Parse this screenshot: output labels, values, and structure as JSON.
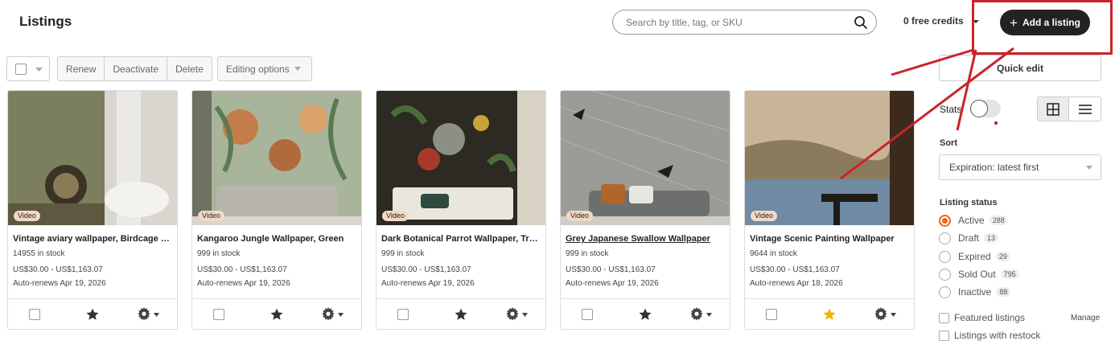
{
  "header": {
    "title": "Listings",
    "search_placeholder": "Search by title, tag, or SKU",
    "credits": "0 free credits",
    "add_button": "Add a listing"
  },
  "toolbar": {
    "renew": "Renew",
    "deactivate": "Deactivate",
    "delete": "Delete",
    "editing_options": "Editing options"
  },
  "listings": [
    {
      "title": "Vintage aviary wallpaper, Birdcage wallpaper",
      "stock": "14955 in stock",
      "price": "US$30.00 - US$1,163.07",
      "renews": "Auto-renews Apr 19, 2026",
      "badge": "Video",
      "featured": false,
      "title_underlined": false
    },
    {
      "title": "Kangaroo Jungle Wallpaper, Green",
      "stock": "999 in stock",
      "price": "US$30.00 - US$1,163.07",
      "renews": "Auto-renews Apr 19, 2026",
      "badge": "Video",
      "featured": false,
      "title_underlined": false
    },
    {
      "title": "Dark Botanical Parrot Wallpaper, Tropical",
      "stock": "999 in stock",
      "price": "US$30.00 - US$1,163.07",
      "renews": "Auto-renews Apr 19, 2026",
      "badge": "Video",
      "featured": false,
      "title_underlined": false
    },
    {
      "title": "Grey Japanese Swallow Wallpaper",
      "stock": "999 in stock",
      "price": "US$30.00 - US$1,163.07",
      "renews": "Auto-renews Apr 19, 2026",
      "badge": "Video",
      "featured": false,
      "title_underlined": true
    },
    {
      "title": "Vintage Scenic Painting Wallpaper",
      "stock": "9644 in stock",
      "price": "US$30.00 - US$1,163.07",
      "renews": "Auto-renews Apr 18, 2026",
      "badge": "Video",
      "featured": true,
      "title_underlined": false
    }
  ],
  "sidebar": {
    "quick_edit": "Quick edit",
    "stats_label": "Stats",
    "sort_label": "Sort",
    "sort_value": "Expiration: latest first",
    "status_label": "Listing status",
    "statuses": [
      {
        "label": "Active",
        "count": "288",
        "selected": true
      },
      {
        "label": "Draft",
        "count": "13",
        "selected": false
      },
      {
        "label": "Expired",
        "count": "29",
        "selected": false
      },
      {
        "label": "Sold Out",
        "count": "795",
        "selected": false
      },
      {
        "label": "Inactive",
        "count": "88",
        "selected": false
      }
    ],
    "featured_listings": "Featured listings",
    "manage": "Manage",
    "listings_with_restock": "Listings with restock"
  },
  "colors": {
    "accent": "#f1641e",
    "button_dark": "#222222",
    "annotation": "#c8242b",
    "featured_star": "#f1b600"
  },
  "icons": {
    "search": "search-icon",
    "add": "plus-icon",
    "star": "star-icon",
    "gear": "gear-icon",
    "grid_view": "grid-view-icon",
    "list_view": "list-view-icon"
  }
}
